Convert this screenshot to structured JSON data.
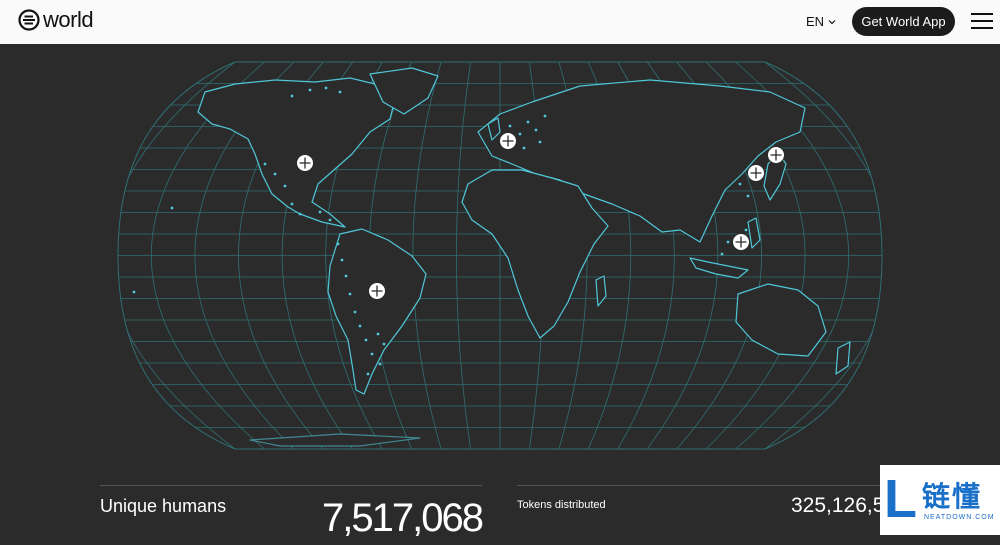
{
  "header": {
    "logo_text": "world",
    "language": "EN",
    "cta_label": "Get World App"
  },
  "colors": {
    "background": "#2b2b2b",
    "map_lines": "#2f6f74",
    "coast": "#4fc7d8",
    "marker": "#ffffff"
  },
  "map": {
    "markers": [
      {
        "id": "north-america"
      },
      {
        "id": "south-america"
      },
      {
        "id": "europe"
      },
      {
        "id": "japan"
      },
      {
        "id": "korea"
      },
      {
        "id": "southeast-asia"
      }
    ]
  },
  "stats": {
    "humans_label": "Unique humans",
    "humans_value": "7,517,068",
    "tokens_label": "Tokens distributed",
    "tokens_value": "325,126,55"
  },
  "watermark": {
    "letter": "L",
    "cn": "链懂",
    "en": "NEATDOWN.COM"
  }
}
